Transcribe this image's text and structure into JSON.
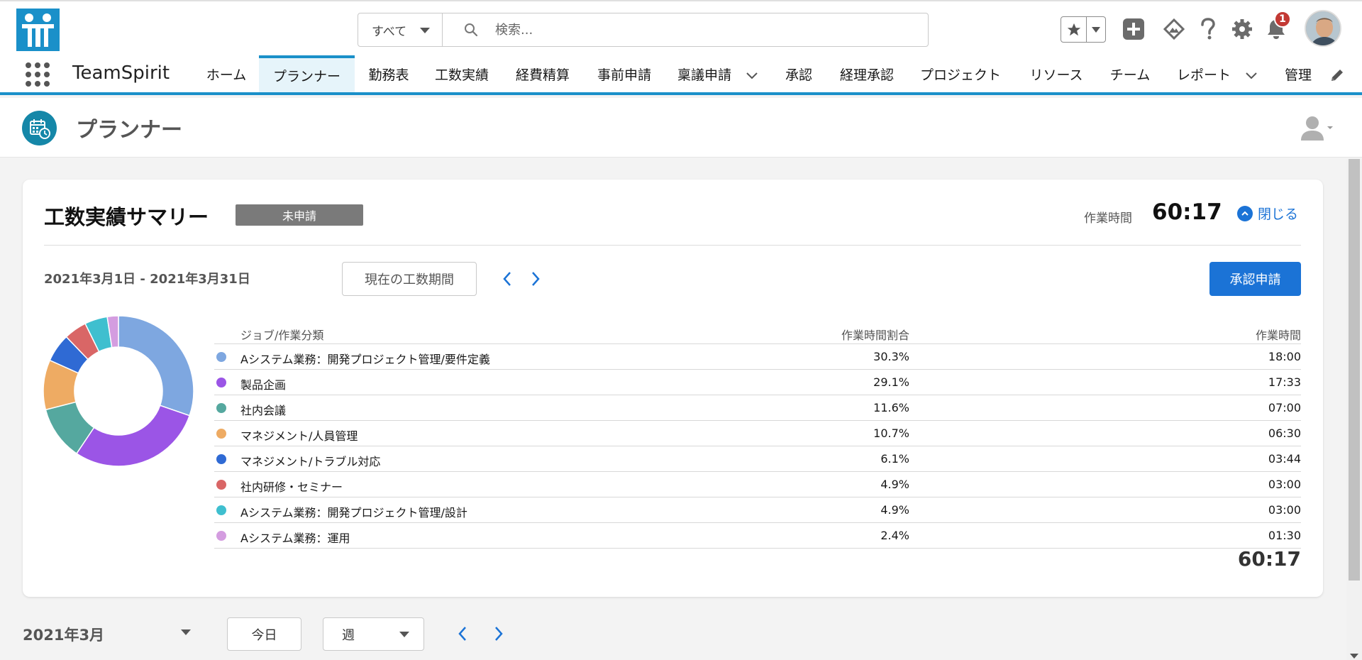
{
  "search": {
    "scope": "すべて",
    "placeholder": "検索..."
  },
  "header": {
    "notification_count": "1"
  },
  "nav": {
    "app_name": "TeamSpirit",
    "tabs": [
      {
        "label": "ホーム"
      },
      {
        "label": "プランナー",
        "active": true
      },
      {
        "label": "勤務表"
      },
      {
        "label": "工数実績"
      },
      {
        "label": "経費精算"
      },
      {
        "label": "事前申請"
      },
      {
        "label": "稟議申請",
        "has_menu": true
      },
      {
        "label": "承認"
      },
      {
        "label": "経理承認"
      },
      {
        "label": "プロジェクト"
      },
      {
        "label": "リソース"
      },
      {
        "label": "チーム"
      },
      {
        "label": "レポート",
        "has_menu": true
      },
      {
        "label": "管理"
      }
    ]
  },
  "page": {
    "title": "プランナー"
  },
  "summary": {
    "title": "工数実績サマリー",
    "status": "未申請",
    "work_time_label": "作業時間",
    "work_time_value": "60:17",
    "close_label": "閉じる",
    "period": "2021年3月1日 - 2021年3月31日",
    "current_period_button": "現在の工数期間",
    "submit_button": "承認申請",
    "table": {
      "headers": {
        "job": "ジョブ/作業分類",
        "ratio": "作業時間割合",
        "time": "作業時間"
      },
      "rows": [
        {
          "job": "Aシステム業務：開発プロジェクト管理/要件定義",
          "ratio": "30.3%",
          "time": "18:00",
          "color": "#7ea7e0"
        },
        {
          "job": "製品企画",
          "ratio": "29.1%",
          "time": "17:33",
          "color": "#9b55e6"
        },
        {
          "job": "社内会議",
          "ratio": "11.6%",
          "time": "07:00",
          "color": "#55a89f"
        },
        {
          "job": "マネジメント/人員管理",
          "ratio": "10.7%",
          "time": "06:30",
          "color": "#eeab63"
        },
        {
          "job": "マネジメント/トラブル対応",
          "ratio": "6.1%",
          "time": "03:44",
          "color": "#2f6ad4"
        },
        {
          "job": "社内研修・セミナー",
          "ratio": "4.9%",
          "time": "03:00",
          "color": "#d96666"
        },
        {
          "job": "Aシステム業務：開発プロジェクト管理/設計",
          "ratio": "4.9%",
          "time": "03:00",
          "color": "#3fbfcf"
        },
        {
          "job": "Aシステム業務：運用",
          "ratio": "2.4%",
          "time": "01:30",
          "color": "#d49de0"
        }
      ],
      "total": "60:17"
    }
  },
  "chart_data": {
    "type": "pie",
    "categories": [
      "Aシステム業務：開発プロジェクト管理/要件定義",
      "製品企画",
      "社内会議",
      "マネジメント/人員管理",
      "マネジメント/トラブル対応",
      "社内研修・セミナー",
      "Aシステム業務：開発プロジェクト管理/設計",
      "Aシステム業務：運用"
    ],
    "values": [
      30.3,
      29.1,
      11.6,
      10.7,
      6.1,
      4.9,
      4.9,
      2.4
    ],
    "colors": [
      "#7ea7e0",
      "#9b55e6",
      "#55a89f",
      "#eeab63",
      "#2f6ad4",
      "#d96666",
      "#3fbfcf",
      "#d49de0"
    ],
    "donut": true
  },
  "toolbar": {
    "month": "2021年3月",
    "today_button": "今日",
    "view_select": "週"
  }
}
